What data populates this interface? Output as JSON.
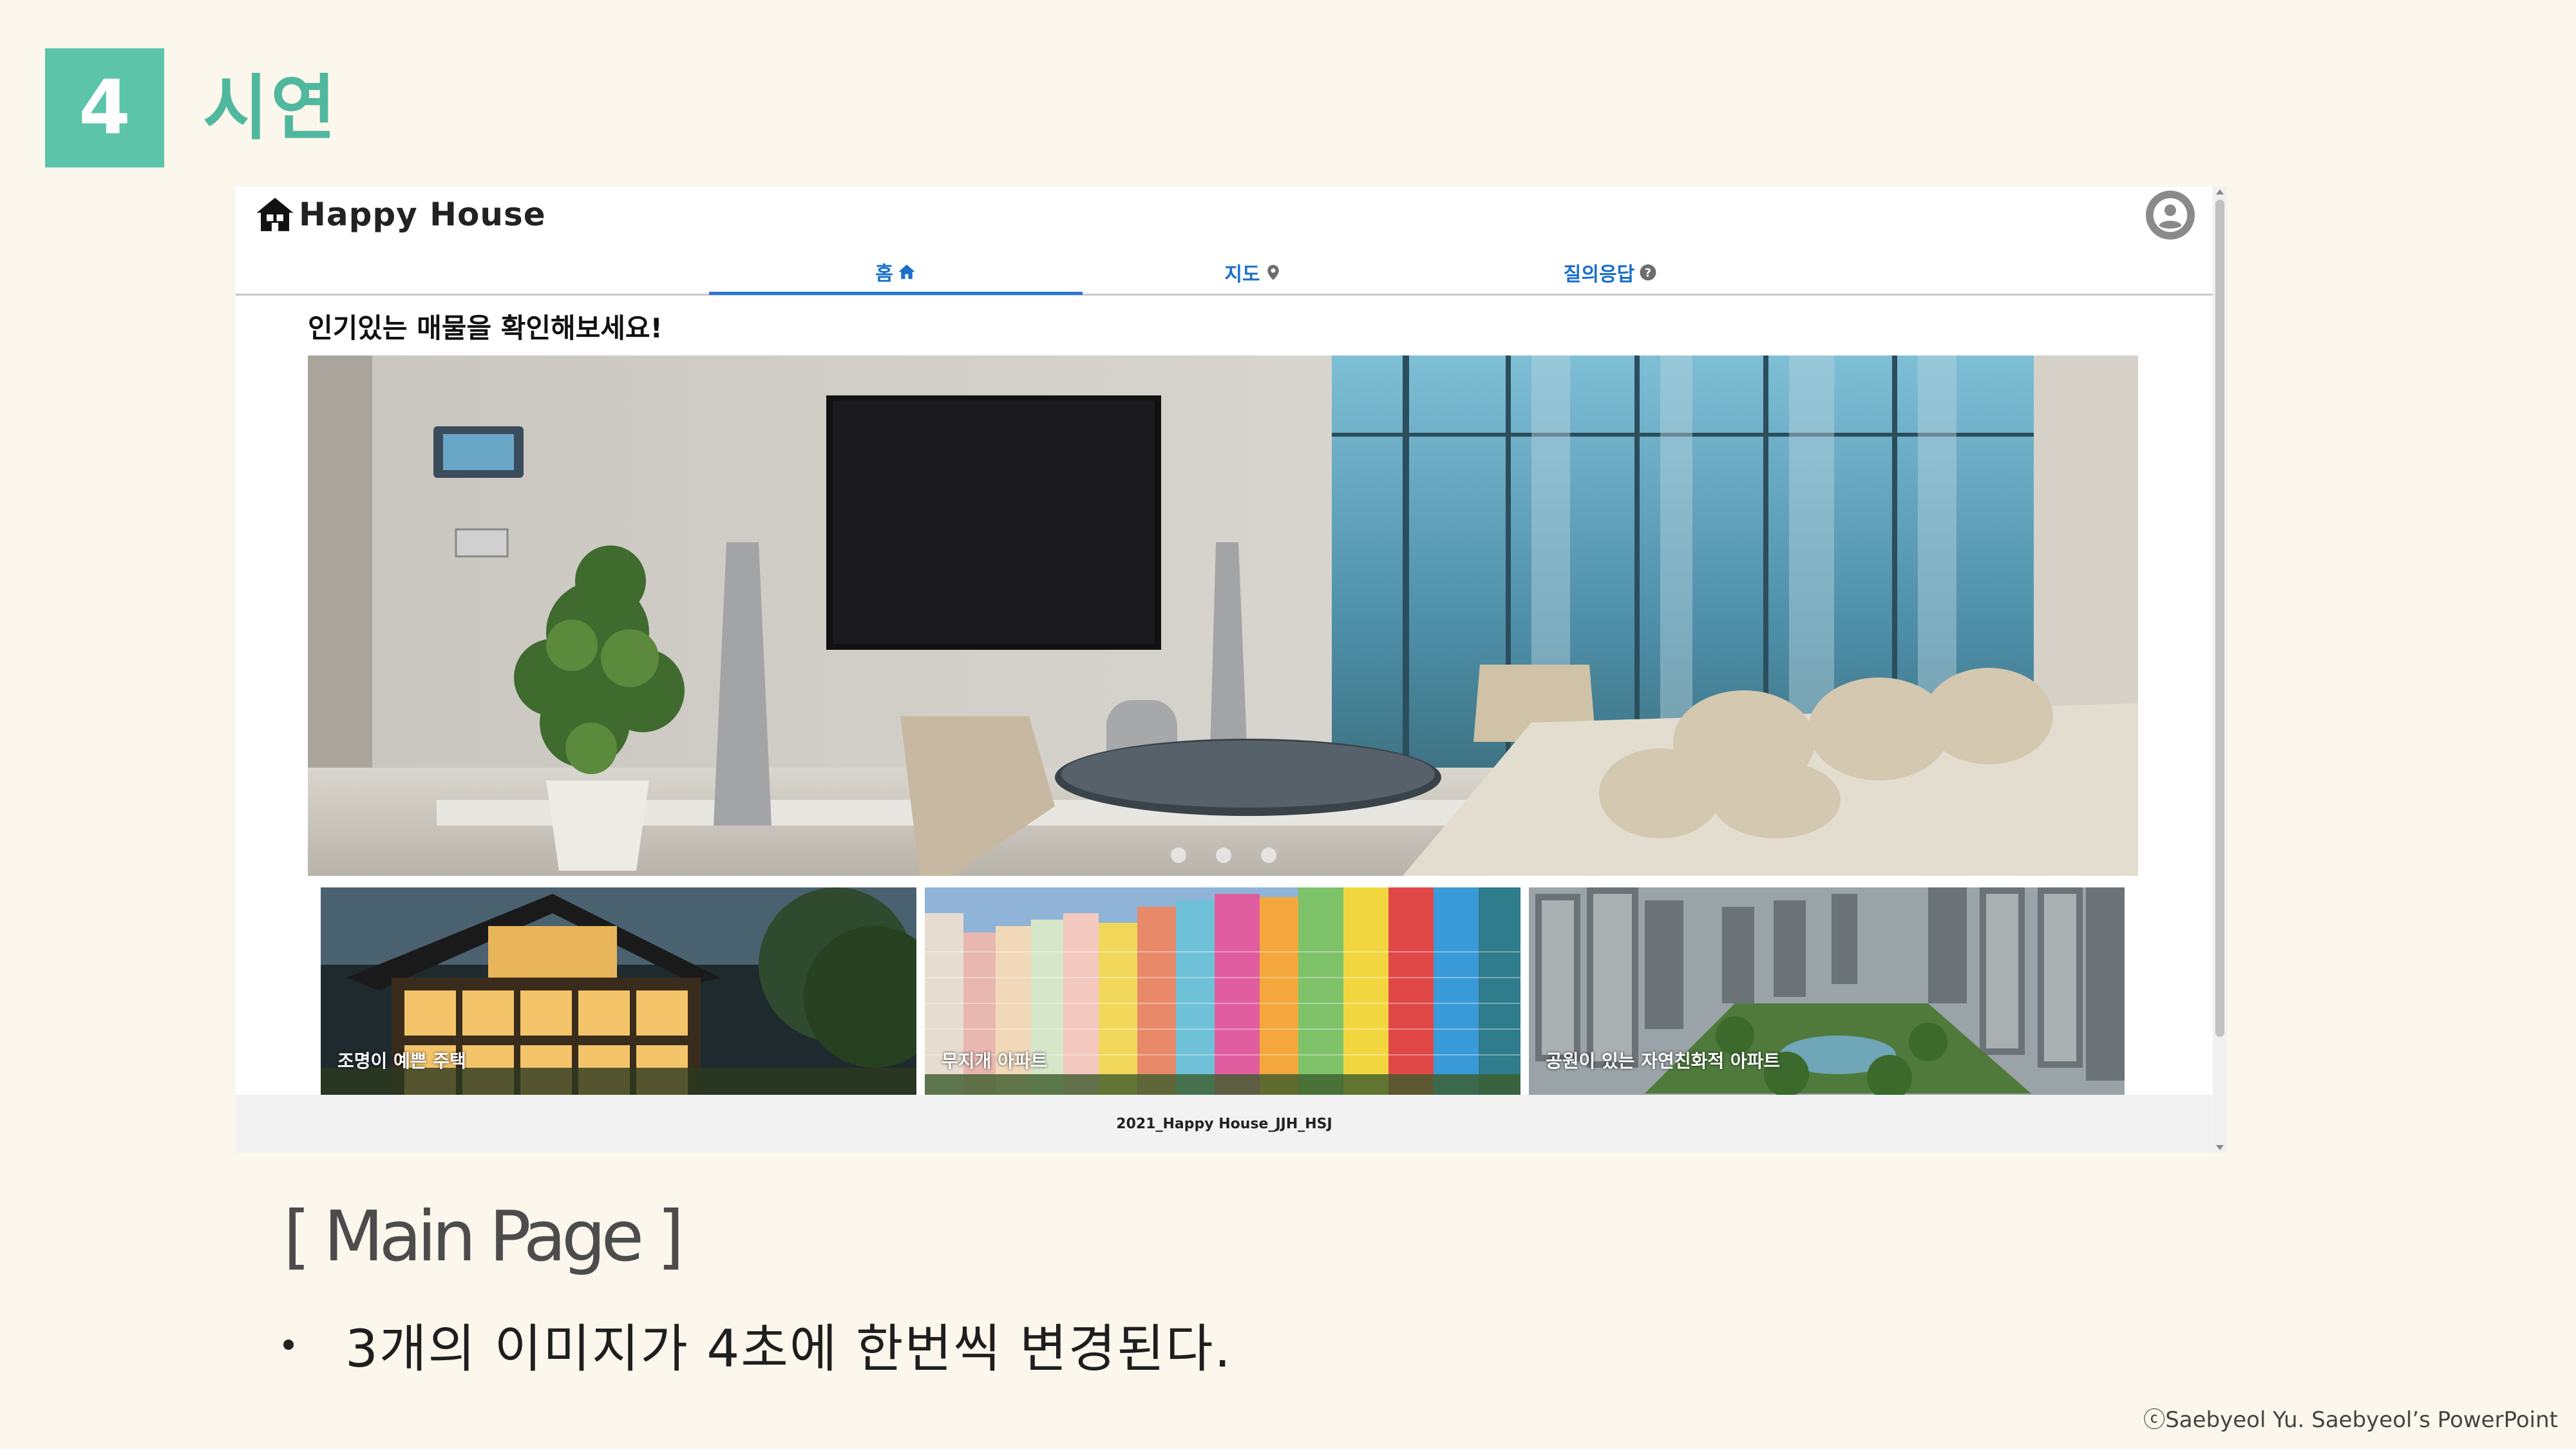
{
  "slide": {
    "section_number": "4",
    "section_title": "시연",
    "caption_heading": "[ Main Page ]",
    "bullet": "3개의 이미지가 4초에 한번씩 변경된다.",
    "copyright": "ⓒSaebyeol Yu. Saebyeol’s PowerPoint"
  },
  "app": {
    "logo_text": "Happy House",
    "logo_icon": "house-icon",
    "profile_icon": "account-circle-icon",
    "nav": [
      {
        "label": "홈",
        "icon": "home-icon",
        "active": true
      },
      {
        "label": "지도",
        "icon": "map-pin-icon",
        "active": false
      },
      {
        "label": "질의응답",
        "icon": "question-circle-icon",
        "active": false
      }
    ],
    "headline": "인기있는 매물을 확인해보세요!",
    "carousel": {
      "slides": 3,
      "active_index": 0
    },
    "cards": [
      {
        "caption": "조명이 예쁜 주택"
      },
      {
        "caption": "무지개 아파트"
      },
      {
        "caption": "공원이 있는 자연친화적 아파트"
      }
    ],
    "footer": "2021_Happy House_JJH_HSJ"
  },
  "colors": {
    "background": "#fbf7ec",
    "accent": "#5cc4a8",
    "link": "#1a6fc9"
  }
}
